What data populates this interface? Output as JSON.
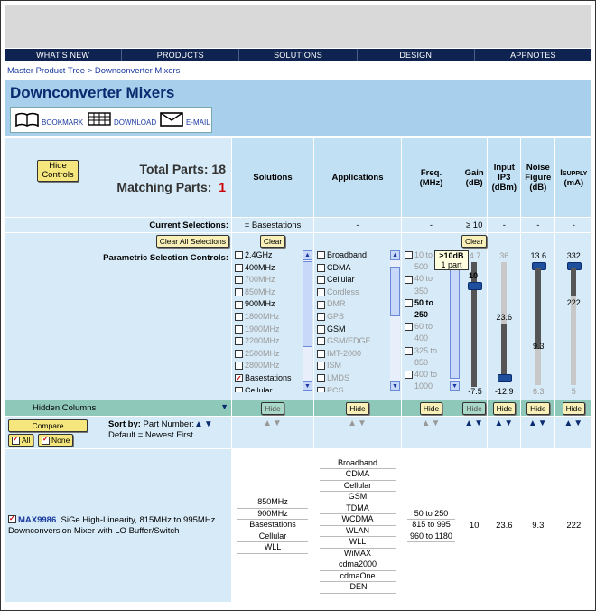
{
  "nav": [
    "WHAT'S NEW",
    "PRODUCTS",
    "SOLUTIONS",
    "DESIGN",
    "APPNOTES"
  ],
  "breadcrumb": {
    "root": "Master Product Tree",
    "separator": " > ",
    "current": "Downconverter Mixers"
  },
  "page_title": "Downconverter Mixers",
  "tools": {
    "bookmark": "BOOKMARK",
    "download": "DOWNLOAD",
    "email": "E-MAIL"
  },
  "summary": {
    "hide_controls": "Hide Controls",
    "total_label": "Total Parts:",
    "total_value": "18",
    "matching_label": "Matching Parts:",
    "matching_value": "1"
  },
  "columns": {
    "solutions": "Solutions",
    "applications": "Applications",
    "freq": "Freq.",
    "freq_unit": "(MHz)",
    "gain": "Gain",
    "gain_unit": "(dB)",
    "ip3": "Input",
    "ip3_b": "IP3",
    "ip3_unit": "(dBm)",
    "nf": "Noise",
    "nf_b": "Figure",
    "nf_unit": "(dB)",
    "isupply_i": "I",
    "isupply_sub": "SUPPLY",
    "isupply_unit": "(mA)"
  },
  "current": {
    "label": "Current Selections:",
    "solutions": "= Basestations",
    "applications": "-",
    "freq": "-",
    "gain": "≥ 10",
    "ip3": "-",
    "nf": "-",
    "isupply": "-"
  },
  "buttons": {
    "clear_all": "Clear All Selections",
    "clear": "Clear",
    "hide": "Hide",
    "compare": "Compare",
    "all": "All",
    "none": "None"
  },
  "parametric_label": "Parametric Selection Controls:",
  "solutions_list": [
    {
      "label": "2.4GHz",
      "active": true,
      "checked": false
    },
    {
      "label": "400MHz",
      "active": true,
      "checked": false
    },
    {
      "label": "700MHz",
      "active": false,
      "checked": false
    },
    {
      "label": "850MHz",
      "active": false,
      "checked": false
    },
    {
      "label": "900MHz",
      "active": true,
      "checked": false
    },
    {
      "label": "1800MHz",
      "active": false,
      "checked": false
    },
    {
      "label": "1900MHz",
      "active": false,
      "checked": false
    },
    {
      "label": "2200MHz",
      "active": false,
      "checked": false
    },
    {
      "label": "2500MHz",
      "active": false,
      "checked": false
    },
    {
      "label": "2800MHz",
      "active": false,
      "checked": false
    },
    {
      "label": "Basestations",
      "active": true,
      "checked": true
    },
    {
      "label": "Cellular",
      "active": true,
      "checked": false
    }
  ],
  "applications_list": [
    {
      "label": "Broadband",
      "active": true
    },
    {
      "label": "CDMA",
      "active": true
    },
    {
      "label": "Cellular",
      "active": true
    },
    {
      "label": "Cordless",
      "active": false
    },
    {
      "label": "DMR",
      "active": false
    },
    {
      "label": "GPS",
      "active": false
    },
    {
      "label": "GSM",
      "active": true
    },
    {
      "label": "GSM/EDGE",
      "active": false
    },
    {
      "label": "IMT-2000",
      "active": false
    },
    {
      "label": "ISM",
      "active": false
    },
    {
      "label": "LMDS",
      "active": false
    },
    {
      "label": "PCS",
      "active": false
    }
  ],
  "freq_list": [
    {
      "label": "10 to",
      "active": false,
      "box": true
    },
    {
      "label": "500",
      "active": false,
      "box": false
    },
    {
      "label": "40 to",
      "active": false,
      "box": true
    },
    {
      "label": "350",
      "active": false,
      "box": false
    },
    {
      "label": "50 to",
      "active": true,
      "box": true
    },
    {
      "label": "250",
      "active": true,
      "box": false
    },
    {
      "label": "60 to",
      "active": false,
      "box": true
    },
    {
      "label": "400",
      "active": false,
      "box": false
    },
    {
      "label": "325 to",
      "active": false,
      "box": true
    },
    {
      "label": "850",
      "active": false,
      "box": false
    },
    {
      "label": "400 to",
      "active": false,
      "box": true
    },
    {
      "label": "1000",
      "active": false,
      "box": false
    }
  ],
  "tooltip": {
    "line1": "≥10dB",
    "line2": "1 part"
  },
  "sliders": {
    "gain": {
      "top": "4.7",
      "value": "10",
      "bottom": "-7.5"
    },
    "ip3": {
      "top": "36",
      "value": "23.6",
      "bottom": "-12.9"
    },
    "nf": {
      "top": "13.6",
      "value": "9.3",
      "bottom": "6.3"
    },
    "isupply": {
      "top": "332",
      "value": "222",
      "bottom": "5"
    }
  },
  "hidden_columns": "Hidden Columns",
  "sort": {
    "label": "Sort by:",
    "field": "Part Number:",
    "default": "Default = Newest First"
  },
  "part": {
    "number": "MAX9986",
    "description": "SiGe High-Linearity, 815MHz to 995MHz Downconversion Mixer with LO Buffer/Switch",
    "solutions": [
      "850MHz",
      "900MHz",
      "Basestations",
      "Cellular",
      "WLL"
    ],
    "applications": [
      "Broadband",
      "CDMA",
      "Cellular",
      "GSM",
      "TDMA",
      "WCDMA",
      "WLAN",
      "WLL",
      "WiMAX",
      "cdma2000",
      "cdmaOne",
      "iDEN"
    ],
    "freq": [
      "50 to 250",
      "815 to 995",
      "960 to 1180"
    ],
    "gain": "10",
    "ip3": "23.6",
    "nf": "9.3",
    "isupply": "222"
  },
  "colors": {
    "nav": "#0f2350",
    "header_blue": "#a8d0ec",
    "light_blue": "#d6eaf7",
    "teal": "#8ec8b8",
    "button_yellow": "#f8f0b8",
    "link": "#1a3aa0",
    "matching_red": "#cc0000"
  }
}
